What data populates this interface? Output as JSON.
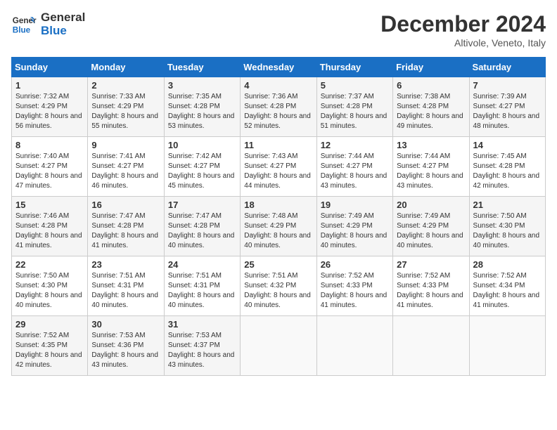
{
  "header": {
    "logo_line1": "General",
    "logo_line2": "Blue",
    "month": "December 2024",
    "location": "Altivole, Veneto, Italy"
  },
  "weekdays": [
    "Sunday",
    "Monday",
    "Tuesday",
    "Wednesday",
    "Thursday",
    "Friday",
    "Saturday"
  ],
  "weeks": [
    [
      {
        "day": "1",
        "sunrise": "7:32 AM",
        "sunset": "4:29 PM",
        "daylight": "8 hours and 56 minutes."
      },
      {
        "day": "2",
        "sunrise": "7:33 AM",
        "sunset": "4:29 PM",
        "daylight": "8 hours and 55 minutes."
      },
      {
        "day": "3",
        "sunrise": "7:35 AM",
        "sunset": "4:28 PM",
        "daylight": "8 hours and 53 minutes."
      },
      {
        "day": "4",
        "sunrise": "7:36 AM",
        "sunset": "4:28 PM",
        "daylight": "8 hours and 52 minutes."
      },
      {
        "day": "5",
        "sunrise": "7:37 AM",
        "sunset": "4:28 PM",
        "daylight": "8 hours and 51 minutes."
      },
      {
        "day": "6",
        "sunrise": "7:38 AM",
        "sunset": "4:28 PM",
        "daylight": "8 hours and 49 minutes."
      },
      {
        "day": "7",
        "sunrise": "7:39 AM",
        "sunset": "4:27 PM",
        "daylight": "8 hours and 48 minutes."
      }
    ],
    [
      {
        "day": "8",
        "sunrise": "7:40 AM",
        "sunset": "4:27 PM",
        "daylight": "8 hours and 47 minutes."
      },
      {
        "day": "9",
        "sunrise": "7:41 AM",
        "sunset": "4:27 PM",
        "daylight": "8 hours and 46 minutes."
      },
      {
        "day": "10",
        "sunrise": "7:42 AM",
        "sunset": "4:27 PM",
        "daylight": "8 hours and 45 minutes."
      },
      {
        "day": "11",
        "sunrise": "7:43 AM",
        "sunset": "4:27 PM",
        "daylight": "8 hours and 44 minutes."
      },
      {
        "day": "12",
        "sunrise": "7:44 AM",
        "sunset": "4:27 PM",
        "daylight": "8 hours and 43 minutes."
      },
      {
        "day": "13",
        "sunrise": "7:44 AM",
        "sunset": "4:27 PM",
        "daylight": "8 hours and 43 minutes."
      },
      {
        "day": "14",
        "sunrise": "7:45 AM",
        "sunset": "4:28 PM",
        "daylight": "8 hours and 42 minutes."
      }
    ],
    [
      {
        "day": "15",
        "sunrise": "7:46 AM",
        "sunset": "4:28 PM",
        "daylight": "8 hours and 41 minutes."
      },
      {
        "day": "16",
        "sunrise": "7:47 AM",
        "sunset": "4:28 PM",
        "daylight": "8 hours and 41 minutes."
      },
      {
        "day": "17",
        "sunrise": "7:47 AM",
        "sunset": "4:28 PM",
        "daylight": "8 hours and 40 minutes."
      },
      {
        "day": "18",
        "sunrise": "7:48 AM",
        "sunset": "4:29 PM",
        "daylight": "8 hours and 40 minutes."
      },
      {
        "day": "19",
        "sunrise": "7:49 AM",
        "sunset": "4:29 PM",
        "daylight": "8 hours and 40 minutes."
      },
      {
        "day": "20",
        "sunrise": "7:49 AM",
        "sunset": "4:29 PM",
        "daylight": "8 hours and 40 minutes."
      },
      {
        "day": "21",
        "sunrise": "7:50 AM",
        "sunset": "4:30 PM",
        "daylight": "8 hours and 40 minutes."
      }
    ],
    [
      {
        "day": "22",
        "sunrise": "7:50 AM",
        "sunset": "4:30 PM",
        "daylight": "8 hours and 40 minutes."
      },
      {
        "day": "23",
        "sunrise": "7:51 AM",
        "sunset": "4:31 PM",
        "daylight": "8 hours and 40 minutes."
      },
      {
        "day": "24",
        "sunrise": "7:51 AM",
        "sunset": "4:31 PM",
        "daylight": "8 hours and 40 minutes."
      },
      {
        "day": "25",
        "sunrise": "7:51 AM",
        "sunset": "4:32 PM",
        "daylight": "8 hours and 40 minutes."
      },
      {
        "day": "26",
        "sunrise": "7:52 AM",
        "sunset": "4:33 PM",
        "daylight": "8 hours and 41 minutes."
      },
      {
        "day": "27",
        "sunrise": "7:52 AM",
        "sunset": "4:33 PM",
        "daylight": "8 hours and 41 minutes."
      },
      {
        "day": "28",
        "sunrise": "7:52 AM",
        "sunset": "4:34 PM",
        "daylight": "8 hours and 41 minutes."
      }
    ],
    [
      {
        "day": "29",
        "sunrise": "7:52 AM",
        "sunset": "4:35 PM",
        "daylight": "8 hours and 42 minutes."
      },
      {
        "day": "30",
        "sunrise": "7:53 AM",
        "sunset": "4:36 PM",
        "daylight": "8 hours and 43 minutes."
      },
      {
        "day": "31",
        "sunrise": "7:53 AM",
        "sunset": "4:37 PM",
        "daylight": "8 hours and 43 minutes."
      },
      null,
      null,
      null,
      null
    ]
  ],
  "labels": {
    "sunrise": "Sunrise:",
    "sunset": "Sunset:",
    "daylight": "Daylight:"
  }
}
